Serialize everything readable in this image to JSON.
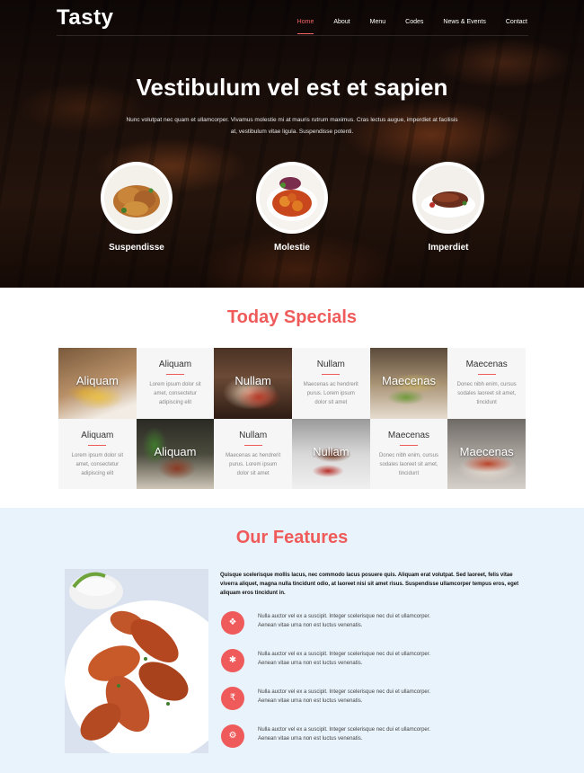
{
  "brand": {
    "name": "Tasty"
  },
  "nav": {
    "items": [
      {
        "label": "Home",
        "active": true
      },
      {
        "label": "About"
      },
      {
        "label": "Menu"
      },
      {
        "label": "Codes"
      },
      {
        "label": "News & Events"
      },
      {
        "label": "Contact"
      }
    ]
  },
  "hero": {
    "title": "Vestibulum vel est et sapien",
    "subtitle": "Nunc volutpat nec quam et ullamcorper. Vivamus molestie mi at mauris rutrum maximus. Cras lectus augue, imperdiet at facilisis at, vestibulum vitae ligula. Suspendisse potenti.",
    "dishes": [
      {
        "name": "Suspendisse",
        "icon": "fried-chicken-photo"
      },
      {
        "name": "Molestie",
        "icon": "stew-photo"
      },
      {
        "name": "Imperdiet",
        "icon": "steak-photo"
      }
    ]
  },
  "specials": {
    "title": "Today Specials",
    "row1": [
      {
        "type": "image",
        "label": "Aliquam",
        "icon": "fries-dish-photo"
      },
      {
        "type": "text",
        "title": "Aliquam",
        "body": "Lorem ipsum dolor sit amet, consectetur adipiscing elit"
      },
      {
        "type": "image",
        "label": "Nullam",
        "icon": "pasta-dish-photo"
      },
      {
        "type": "text",
        "title": "Nullam",
        "body": "Maecenas ac hendrerit purus. Lorem ipsum dolor sit amet"
      },
      {
        "type": "image",
        "label": "Maecenas",
        "icon": "asparagus-dish-photo"
      },
      {
        "type": "text",
        "title": "Maecenas",
        "body": "Donec nibh enim, cursus sodales laoreet sit amet, tincidunt"
      }
    ],
    "row2": [
      {
        "type": "text",
        "title": "Aliquam",
        "body": "Lorem ipsum dolor sit amet, consectetur adipiscing elit"
      },
      {
        "type": "image",
        "label": "Aliquam",
        "icon": "herb-dish-photo"
      },
      {
        "type": "text",
        "title": "Nullam",
        "body": "Maecenas ac hendrerit purus. Lorem ipsum dolor sit amet"
      },
      {
        "type": "image",
        "label": "Nullam",
        "icon": "plated-meat-photo"
      },
      {
        "type": "text",
        "title": "Maecenas",
        "body": "Donec nibh enim, cursus sodales laoreet sit amet, tincidunt"
      },
      {
        "type": "image",
        "label": "Maecenas",
        "icon": "sauce-dish-photo"
      }
    ]
  },
  "features": {
    "title": "Our Features",
    "intro": "Quisque scelerisque mollis lacus, nec commodo lacus posuere quis. Aliquam erat volutpat. Sed laoreet, felis vitae viverra aliquet, magna nulla tincidunt odio, at laoreet nisi sit amet risus. Suspendisse ullamcorper tempus eros, eget aliquam eros tincidunt in.",
    "items": [
      {
        "icon": "gift-icon",
        "line1": "Nulla auctor vel ex a suscipit. Integer scelerisque nec dui et ullamcorper.",
        "line2": "Aenean vitae urna non est luctus venenatis."
      },
      {
        "icon": "star-icon",
        "line1": "Nulla auctor vel ex a suscipit. Integer scelerisque nec dui et ullamcorper.",
        "line2": "Aenean vitae urna non est luctus venenatis."
      },
      {
        "icon": "rupee-icon",
        "line1": "Nulla auctor vel ex a suscipit. Integer scelerisque nec dui et ullamcorper.",
        "line2": "Aenean vitae urna non est luctus venenatis."
      },
      {
        "icon": "gear-icon",
        "line1": "Nulla auctor vel ex a suscipit. Integer scelerisque nec dui et ullamcorper.",
        "line2": "Aenean vitae urna non est luctus venenatis."
      }
    ]
  },
  "colors": {
    "accent": "#ef5b5b",
    "features_bg": "#e9f3fb",
    "cell_bg": "#f6f6f6"
  }
}
